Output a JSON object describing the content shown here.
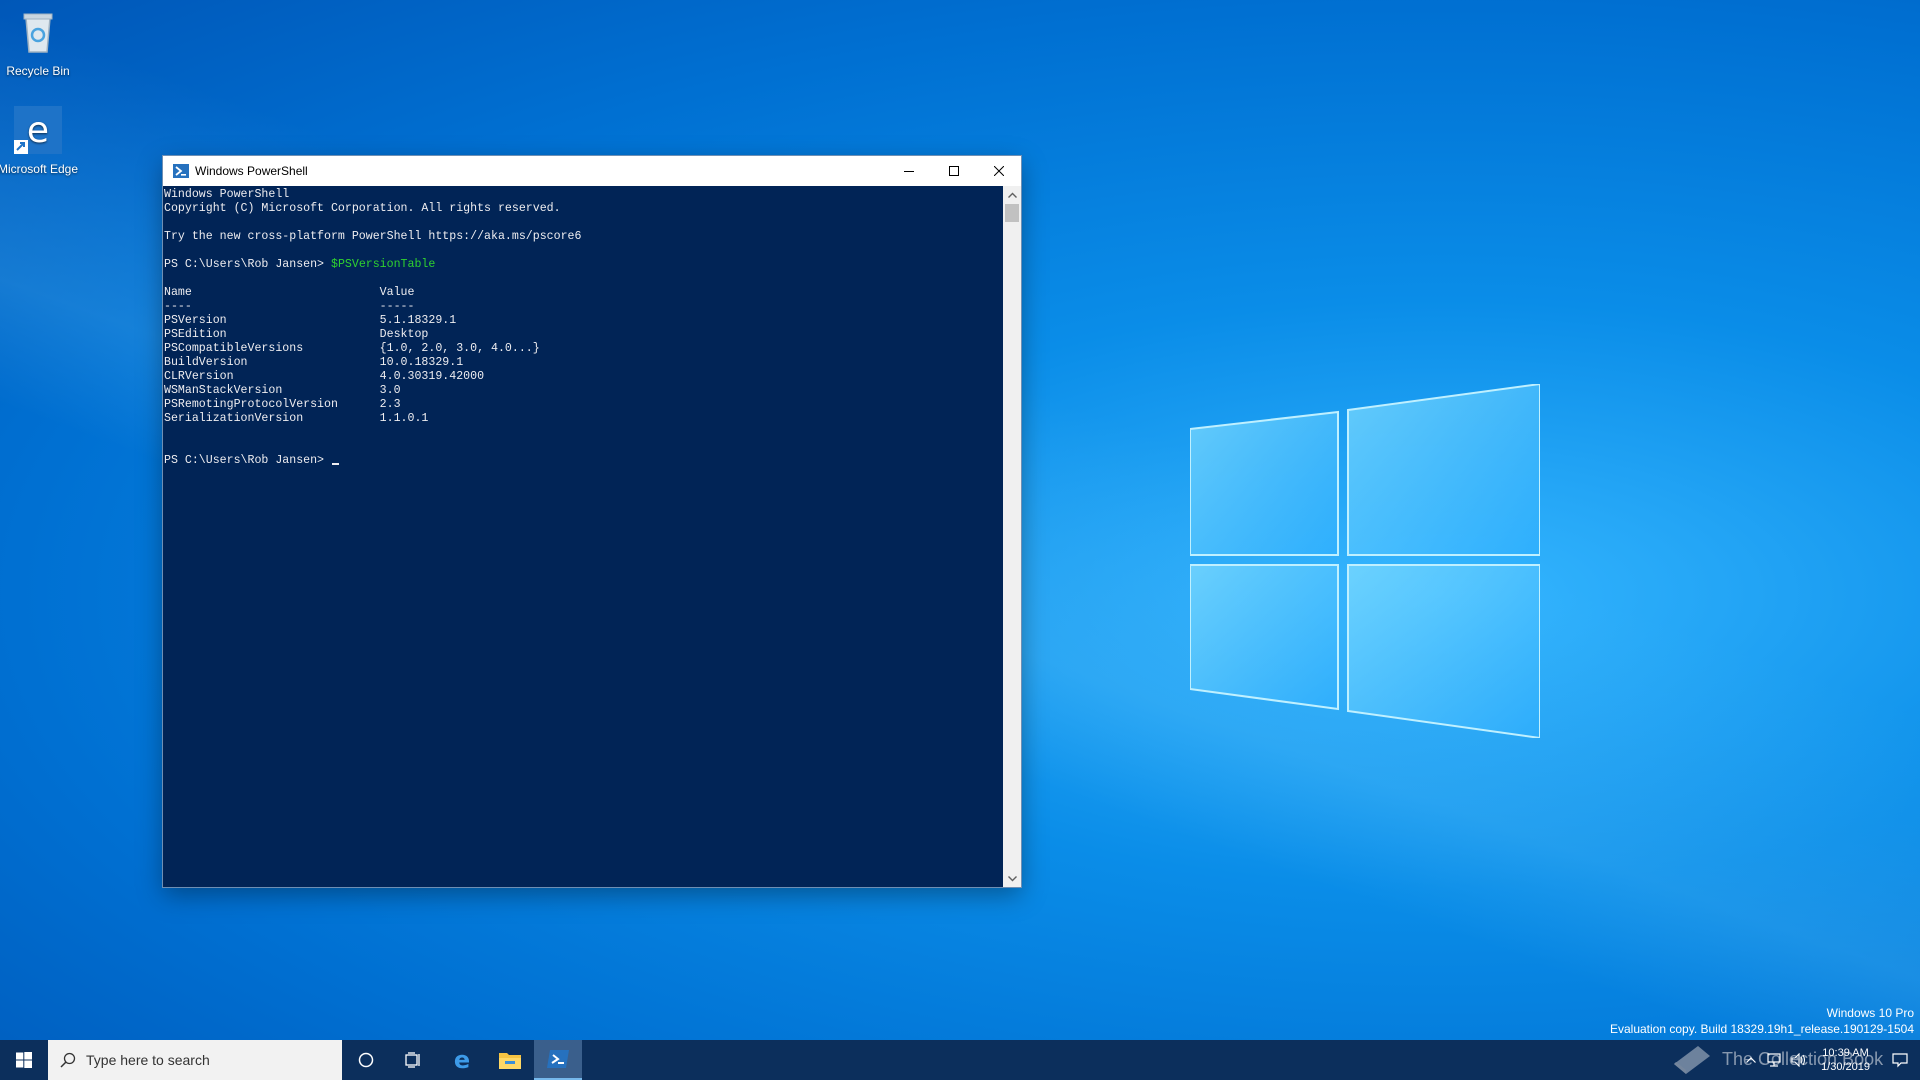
{
  "desktop": {
    "icons": [
      {
        "label": "Recycle Bin",
        "icon": "recycle-bin-icon"
      },
      {
        "label": "Microsoft Edge",
        "icon": "edge-icon"
      }
    ],
    "watermark": {
      "line1": "Windows 10 Pro",
      "line2": "Evaluation copy. Build 18329.19h1_release.190129-1504"
    }
  },
  "window": {
    "title": "Windows PowerShell",
    "console": {
      "lines": [
        "Windows PowerShell",
        "Copyright (C) Microsoft Corporation. All rights reserved.",
        "",
        "Try the new cross-platform PowerShell https://aka.ms/pscore6",
        ""
      ],
      "prompt": "PS C:\\Users\\Rob Jansen> ",
      "command": "$PSVersionTable",
      "table_header": "Name                           Value",
      "table_rule": "----                           -----",
      "rows": [
        "PSVersion                      5.1.18329.1",
        "PSEdition                      Desktop",
        "PSCompatibleVersions           {1.0, 2.0, 3.0, 4.0...}",
        "BuildVersion                   10.0.18329.1",
        "CLRVersion                     4.0.30319.42000",
        "WSManStackVersion              3.0",
        "PSRemotingProtocolVersion      2.3",
        "SerializationVersion           1.1.0.1"
      ]
    },
    "colors": {
      "console_bg": "#012456",
      "command": "#2fd12f",
      "text": "#eeedf0"
    }
  },
  "taskbar": {
    "search_placeholder": "Type here to search",
    "buttons": [
      "start-icon",
      "cortana-icon",
      "task-view-icon",
      "edge-icon",
      "file-explorer-icon",
      "powershell-icon"
    ],
    "clock_time": "10:39 AM",
    "clock_date": "1/30/2019",
    "brand_watermark": "The Collection Book"
  }
}
